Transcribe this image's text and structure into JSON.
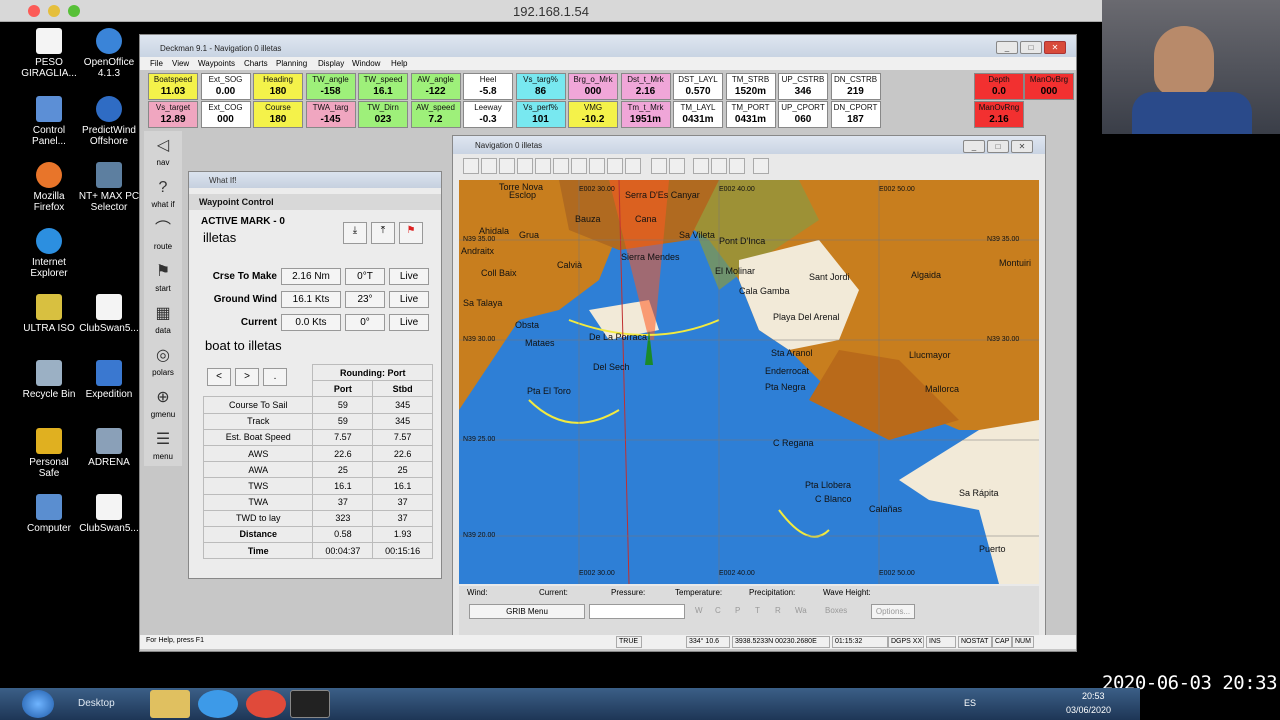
{
  "viewer": {
    "title": "192.168.1.54"
  },
  "desktop_icons": [
    {
      "label": "PESO GIRAGLIA..."
    },
    {
      "label": "OpenOffice 4.1.3"
    },
    {
      "label": "Control Panel..."
    },
    {
      "label": "PredictWind Offshore"
    },
    {
      "label": "Mozilla Firefox"
    },
    {
      "label": "NT+ MAX PC Selector"
    },
    {
      "label": "Internet Explorer"
    },
    {
      "label": "ULTRA ISO"
    },
    {
      "label": "ClubSwan5..."
    },
    {
      "label": "Recycle Bin"
    },
    {
      "label": "Expedition"
    },
    {
      "label": "Personal Safe"
    },
    {
      "label": "ADRENA"
    },
    {
      "label": "Computer"
    },
    {
      "label": "ClubSwan5..."
    }
  ],
  "app": {
    "title": "Deckman 9.1 - Navigation 0 illetas",
    "menu": [
      "File",
      "View",
      "Waypoints",
      "Charts",
      "Planning",
      "Display",
      "Window",
      "Help"
    ],
    "gauges_row1": [
      {
        "label": "Boatspeed",
        "value": "11.03",
        "color": "#f4f24a"
      },
      {
        "label": "Ext_SOG",
        "value": "0.00",
        "color": "#ffffff"
      },
      {
        "label": "Heading",
        "value": "180",
        "color": "#f4f24a"
      },
      {
        "label": "TW_angle",
        "value": "-158",
        "color": "#9ef07a"
      },
      {
        "label": "TW_speed",
        "value": "16.1",
        "color": "#9ef07a"
      },
      {
        "label": "AW_angle",
        "value": "-122",
        "color": "#9ef07a"
      },
      {
        "label": "Heel",
        "value": "-5.8",
        "color": "#ffffff"
      },
      {
        "label": "Vs_targ%",
        "value": "86",
        "color": "#78e8f0"
      },
      {
        "label": "Brg_o_Mrk",
        "value": "000",
        "color": "#f0a6d8"
      },
      {
        "label": "Dst_t_Mrk",
        "value": "2.16",
        "color": "#f0a6d8"
      },
      {
        "label": "DST_LAYL",
        "value": "0.570",
        "color": "#ffffff"
      },
      {
        "label": "TM_STRB",
        "value": "1520m",
        "color": "#ffffff"
      },
      {
        "label": "UP_CSTRB",
        "value": "346",
        "color": "#ffffff"
      },
      {
        "label": "DN_CSTRB",
        "value": "219",
        "color": "#ffffff"
      },
      {
        "label": "Depth",
        "value": "0.0",
        "color": "#f23030"
      },
      {
        "label": "ManOvBrg",
        "value": "000",
        "color": "#f23030"
      }
    ],
    "gauges_row2": [
      {
        "label": "Vs_target",
        "value": "12.89",
        "color": "#f0a6c0"
      },
      {
        "label": "Ext_COG",
        "value": "000",
        "color": "#ffffff"
      },
      {
        "label": "Course",
        "value": "180",
        "color": "#f4f24a"
      },
      {
        "label": "TWA_targ",
        "value": "-145",
        "color": "#f0a6c0"
      },
      {
        "label": "TW_Dirn",
        "value": "023",
        "color": "#9ef07a"
      },
      {
        "label": "AW_speed",
        "value": "7.2",
        "color": "#9ef07a"
      },
      {
        "label": "Leeway",
        "value": "-0.3",
        "color": "#ffffff"
      },
      {
        "label": "Vs_perf%",
        "value": "101",
        "color": "#78e8f0"
      },
      {
        "label": "VMG",
        "value": "-10.2",
        "color": "#f4f24a"
      },
      {
        "label": "Tm_t_Mrk",
        "value": "1951m",
        "color": "#f0a6d8"
      },
      {
        "label": "TM_LAYL",
        "value": "0431m",
        "color": "#ffffff"
      },
      {
        "label": "TM_PORT",
        "value": "0431m",
        "color": "#ffffff"
      },
      {
        "label": "UP_CPORT",
        "value": "060",
        "color": "#ffffff"
      },
      {
        "label": "DN_CPORT",
        "value": "187",
        "color": "#ffffff"
      },
      {
        "label": "ManOvRng",
        "value": "2.16",
        "color": "#f23030"
      }
    ],
    "sidebar": [
      {
        "label": "nav",
        "glyph": "◁"
      },
      {
        "label": "what if",
        "glyph": "?"
      },
      {
        "label": "route",
        "glyph": "⌒"
      },
      {
        "label": "start",
        "glyph": "⚑"
      },
      {
        "label": "data",
        "glyph": "▦"
      },
      {
        "label": "polars",
        "glyph": "◎"
      },
      {
        "label": "gmenu",
        "glyph": "⊕"
      },
      {
        "label": "menu",
        "glyph": "☰"
      }
    ],
    "status": {
      "help": "For Help, press F1",
      "s1": "TRUE",
      "s2": "334° 10.6",
      "s3": "3938.5233N 00230.2680E",
      "s4": "01:15:32",
      "s5": "DGPS XX",
      "s6": "INS",
      "s7": "NOSTAT",
      "s8": "CAP",
      "s9": "NUM"
    }
  },
  "whatif": {
    "title": "What If!",
    "panel_title": "Waypoint Control",
    "active_mark_label": "ACTIVE MARK - 0",
    "active_mark_name": "illetas",
    "rows": [
      {
        "label": "Crse To Make",
        "v1": "2.16 Nm",
        "v2": "0°T",
        "btn": "Live"
      },
      {
        "label": "Ground Wind",
        "v1": "16.1 Kts",
        "v2": "23°",
        "btn": "Live"
      },
      {
        "label": "Current",
        "v1": "0.0 Kts",
        "v2": "0°",
        "btn": "Live"
      }
    ],
    "leg": "boat to illetas",
    "rounding": "Rounding: Port",
    "nav_buttons": [
      "<",
      ">",
      "."
    ],
    "col_port": "Port",
    "col_stbd": "Stbd",
    "table": [
      {
        "label": "Course To Sail",
        "port": "59",
        "stbd": "345"
      },
      {
        "label": "Track",
        "port": "59",
        "stbd": "345"
      },
      {
        "label": "Est. Boat Speed",
        "port": "7.57",
        "stbd": "7.57"
      },
      {
        "label": "AWS",
        "port": "22.6",
        "stbd": "22.6"
      },
      {
        "label": "AWA",
        "port": "25",
        "stbd": "25"
      },
      {
        "label": "TWS",
        "port": "16.1",
        "stbd": "16.1"
      },
      {
        "label": "TWA",
        "port": "37",
        "stbd": "37"
      },
      {
        "label": "TWD to lay",
        "port": "323",
        "stbd": "37"
      },
      {
        "label": "Distance",
        "port": "0.58",
        "stbd": "1.93"
      },
      {
        "label": "Time",
        "port": "00:04:37",
        "stbd": "00:15:16"
      }
    ]
  },
  "navwin": {
    "title": "Navigation 0 illetas",
    "places": [
      "Torre Nova",
      "Esclop",
      "Serra D'Es Canyar",
      "Ahidala",
      "Bauza",
      "Cana",
      "Andraitx",
      "Grua",
      "Sa Vileta",
      "Pont D'Inca",
      "Coll Baix",
      "Calvià",
      "Sierra Mendes",
      "El Molinar",
      "Sant Jordi",
      "Algaida",
      "Montuiri",
      "Sa Talaya",
      "Cala Gamba",
      "Obsta",
      "Playa Del Arenal",
      "Mataes",
      "De La Porraca",
      "Sta Aranol",
      "Llucmayor",
      "Del Sech",
      "Enderrocat",
      "Pta Negra",
      "Mallorca",
      "Pta El Toro",
      "C Regana",
      "Pta Llobera",
      "C Blanco",
      "Sa Rápita",
      "Calañas",
      "Puerto"
    ],
    "grid": [
      "E002 30.00",
      "E002 40.00",
      "E002 50.00",
      "N39 35.00",
      "N39 35.00",
      "N39 30.00",
      "N39 30.00",
      "N39 25.00",
      "N39 20.00",
      "E002 30.00",
      "E002 40.00",
      "E002 50.00"
    ],
    "bottom": {
      "wind": "Wind:",
      "current": "Current:",
      "pressure": "Pressure:",
      "temperature": "Temperature:",
      "precip": "Precipitation:",
      "wave": "Wave Height:",
      "grib": "GRIB Menu",
      "w": "W",
      "c": "C",
      "p": "P",
      "t": "T",
      "r": "R",
      "wa": "Wa",
      "boxes": "Boxes",
      "options": "Options..."
    }
  },
  "taskbar": {
    "desktop": "Desktop",
    "lang": "ES",
    "time": "20:53",
    "date": "03/06/2020"
  },
  "timestamp": "2020-06-03 20:33"
}
